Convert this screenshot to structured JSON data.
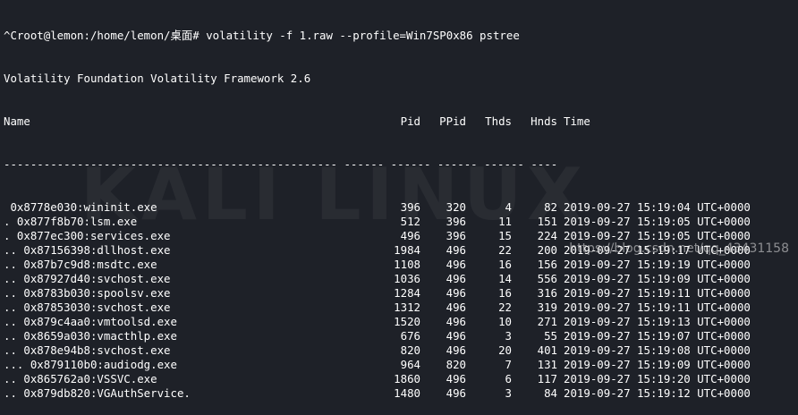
{
  "colors": {
    "background": "#1e2128",
    "text": "#ffffff"
  },
  "cut_line": "                                                                                     ",
  "prompt": {
    "text": "^Croot@lemon:/home/lemon/桌面# volatility -f 1.raw --profile=Win7SP0x86 pstree"
  },
  "banner": "Volatility Foundation Volatility Framework 2.6",
  "table": {
    "headers": {
      "name": "Name",
      "pid": "Pid",
      "ppid": "PPid",
      "thds": "Thds",
      "hnds": "Hnds",
      "time": "Time"
    },
    "separator": "-------------------------------------------------- ------ ------ ------ ------ ----",
    "rows": [
      {
        "name": " 0x8778e030:wininit.exe",
        "pid": "396",
        "ppid": "320",
        "thds": "4",
        "hnds": "82",
        "time": "2019-09-27 15:19:04 UTC+0000"
      },
      {
        "name": ". 0x877f8b70:lsm.exe",
        "pid": "512",
        "ppid": "396",
        "thds": "11",
        "hnds": "151",
        "time": "2019-09-27 15:19:05 UTC+0000"
      },
      {
        "name": ". 0x877ec300:services.exe",
        "pid": "496",
        "ppid": "396",
        "thds": "15",
        "hnds": "224",
        "time": "2019-09-27 15:19:05 UTC+0000"
      },
      {
        "name": ".. 0x87156398:dllhost.exe",
        "pid": "1984",
        "ppid": "496",
        "thds": "22",
        "hnds": "200",
        "time": "2019-09-27 15:19:17 UTC+0000"
      },
      {
        "name": ".. 0x87b7c9d8:msdtc.exe",
        "pid": "1108",
        "ppid": "496",
        "thds": "16",
        "hnds": "156",
        "time": "2019-09-27 15:19:19 UTC+0000"
      },
      {
        "name": ".. 0x87927d40:svchost.exe",
        "pid": "1036",
        "ppid": "496",
        "thds": "14",
        "hnds": "556",
        "time": "2019-09-27 15:19:09 UTC+0000"
      },
      {
        "name": ".. 0x8783b030:spoolsv.exe",
        "pid": "1284",
        "ppid": "496",
        "thds": "16",
        "hnds": "316",
        "time": "2019-09-27 15:19:11 UTC+0000"
      },
      {
        "name": ".. 0x87853030:svchost.exe",
        "pid": "1312",
        "ppid": "496",
        "thds": "22",
        "hnds": "319",
        "time": "2019-09-27 15:19:11 UTC+0000"
      },
      {
        "name": ".. 0x879c4aa0:vmtoolsd.exe",
        "pid": "1520",
        "ppid": "496",
        "thds": "10",
        "hnds": "271",
        "time": "2019-09-27 15:19:13 UTC+0000"
      },
      {
        "name": ".. 0x8659a030:vmacthlp.exe",
        "pid": "676",
        "ppid": "496",
        "thds": "3",
        "hnds": "55",
        "time": "2019-09-27 15:19:07 UTC+0000"
      },
      {
        "name": ".. 0x878e94b8:svchost.exe",
        "pid": "820",
        "ppid": "496",
        "thds": "20",
        "hnds": "401",
        "time": "2019-09-27 15:19:08 UTC+0000"
      },
      {
        "name": "... 0x879110b0:audiodg.exe",
        "pid": "964",
        "ppid": "820",
        "thds": "7",
        "hnds": "131",
        "time": "2019-09-27 15:19:09 UTC+0000"
      },
      {
        "name": ".. 0x865762a0:VSSVC.exe",
        "pid": "1860",
        "ppid": "496",
        "thds": "6",
        "hnds": "117",
        "time": "2019-09-27 15:19:20 UTC+0000"
      },
      {
        "name": ".. 0x879db820:VGAuthService.",
        "pid": "1480",
        "ppid": "496",
        "thds": "3",
        "hnds": "84",
        "time": "2019-09-27 15:19:12 UTC+0000"
      }
    ]
  },
  "watermark": "KALI LINUX",
  "csdn_url": "https://blog.csdn.net/qq_43431158"
}
